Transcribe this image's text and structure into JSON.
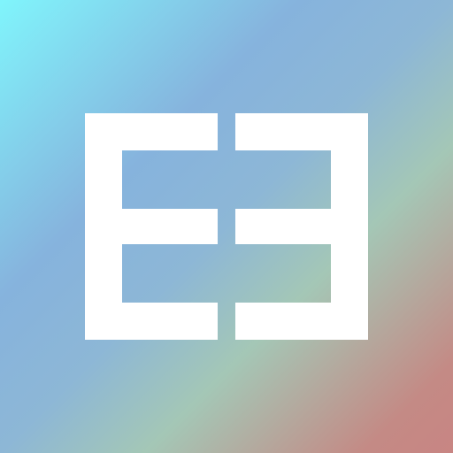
{
  "app": {
    "name": "",
    "icon": "ee-monogram-icon"
  },
  "colors": {
    "background_gradient": [
      "#80f5fc",
      "#86b3dd",
      "#a4c7b6",
      "#c88583"
    ],
    "glyph": "#ffffff"
  }
}
